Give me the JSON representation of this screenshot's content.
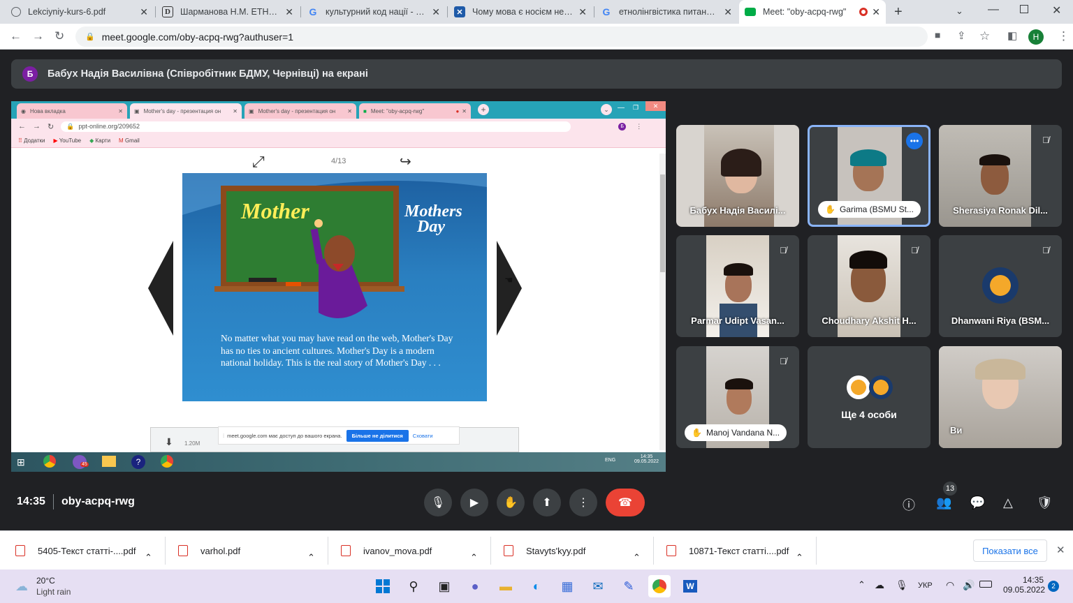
{
  "browser": {
    "tabs": [
      {
        "title": "Lekciyniy-kurs-6.pdf"
      },
      {
        "title": "Шарманова Н.М. ЕТНОЛІН"
      },
      {
        "title": "культурний код нації - Пош"
      },
      {
        "title": "Чому мова є носієм немат"
      },
      {
        "title": "етнолінгвістика питання -"
      },
      {
        "title": "Meet: \"oby-acpq-rwg\""
      }
    ],
    "url": "meet.google.com/oby-acpq-rwg?authuser=1",
    "profile_initial": "H"
  },
  "presenter_bar": {
    "avatar": "Б",
    "text": "Бабух Надія Василівна (Співробітник БДМУ, Чернівці) на екрані"
  },
  "shared_screen": {
    "tabs": [
      {
        "title": "Нова вкладка"
      },
      {
        "title": "Mother's day - презентация он"
      },
      {
        "title": "Mother's day - презентация он"
      },
      {
        "title": "Meet: \"oby-acpq-rwg\""
      }
    ],
    "url": "ppt-online.org/209652",
    "bookmarks": [
      "Додатки",
      "YouTube",
      "Карти",
      "Gmail"
    ],
    "page_counter": "4/13",
    "slide": {
      "board_text": "Mother",
      "title": "Mothers Day",
      "title_line1": "Mothers",
      "title_line2": "Day",
      "body": "No matter what you may have read on the web, Mother's Day has no ties to ancient cultures. Mother's Day is a modern national holiday. This is the real story of Mother's Day . . ."
    },
    "download_size": "1.20M",
    "notice": {
      "text": "meet.google.com має доступ до вашого екрана.",
      "stop_button": "Більше не ділитися",
      "hide_button": "Сховати"
    },
    "taskbar": {
      "lang": "ENG",
      "time": "14:35",
      "date": "09.05.2022",
      "badge": "45"
    }
  },
  "participants": [
    {
      "name": "Бабух Надія Василі...",
      "muted": false
    },
    {
      "name": "Garima (BSMU St...",
      "muted": false,
      "hand": true,
      "active": true
    },
    {
      "name": "Sherasiya Ronak Dil...",
      "muted": true
    },
    {
      "name": "Parmar Udipt Vasan...",
      "muted": true
    },
    {
      "name": "Choudhary Akshit H...",
      "muted": true
    },
    {
      "name": "Dhanwani Riya (BSM...",
      "muted": true
    },
    {
      "name": "Manoj Vandana N...",
      "muted": true,
      "hand": true
    },
    {
      "name": "Ще 4 особи",
      "muted": false
    },
    {
      "name": "Ви",
      "muted": false
    }
  ],
  "controls": {
    "time": "14:35",
    "meeting_code": "oby-acpq-rwg",
    "people_count": "13"
  },
  "downloads": {
    "files": [
      {
        "name": "5405-Текст статті-....pdf"
      },
      {
        "name": "varhol.pdf"
      },
      {
        "name": "ivanov_mova.pdf"
      },
      {
        "name": "Stavyts'kyy.pdf"
      },
      {
        "name": "10871-Текст статті....pdf"
      }
    ],
    "show_all": "Показати все"
  },
  "windows_taskbar": {
    "weather_temp": "20°C",
    "weather_desc": "Light rain",
    "lang": "УКР",
    "time": "14:35",
    "date": "09.05.2022",
    "notif_count": "2"
  },
  "colors": {
    "meet_bg": "#202124",
    "end_call": "#ea4335",
    "active_tile_border": "#8ab4f8",
    "slide_bg": "#2a7fc0"
  }
}
